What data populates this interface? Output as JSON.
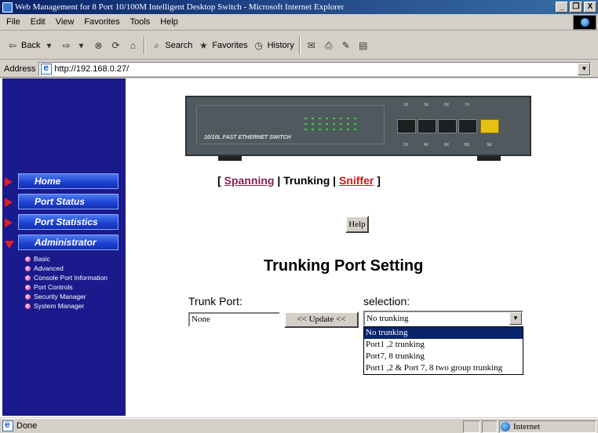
{
  "window": {
    "title": "Web Management for 8 Port 10/100M Intelligent Desktop Switch - Microsoft Internet Explorer",
    "buttons": [
      "_",
      "̅̅̅⨯",
      "X"
    ],
    "minimize": "_",
    "restore": "❒",
    "close": "X"
  },
  "menu": {
    "items": [
      "File",
      "Edit",
      "View",
      "Favorites",
      "Tools",
      "Help"
    ]
  },
  "toolbar": {
    "back": "Back",
    "search": "Search",
    "favorites": "Favorites",
    "history": "History"
  },
  "address": {
    "label": "Address",
    "url": "http://192.168.0.27/"
  },
  "device": {
    "brand": "10/10L FAST ETHERNET SWITCH",
    "port_labels": [
      "1X",
      "3X",
      "5X",
      "7X",
      "2X",
      "4X",
      "6X",
      "8X",
      "SE"
    ]
  },
  "sidebar": {
    "nav": [
      {
        "label": "Home"
      },
      {
        "label": "Port Status"
      },
      {
        "label": "Port Statistics"
      },
      {
        "label": "Administrator"
      }
    ],
    "sub": [
      "Basic",
      "Advanced",
      "Console Port Information",
      "Port Controls",
      "Security Manager",
      "System Manager"
    ]
  },
  "tabs": {
    "open": "[",
    "spanning": "Spanning",
    "sep": "|",
    "trunking": "Trunking",
    "sniffer": "Sniffer",
    "close": "]"
  },
  "help_button": "Help",
  "heading": "Trunking Port Setting",
  "trunk": {
    "label": "Trunk Port:",
    "value": "None",
    "update_button": "<< Update <<"
  },
  "selection": {
    "label": "selection:",
    "selected": "No trunking",
    "options": [
      "No trunking",
      "Port1 ,2 trunking",
      "Port7, 8 trunking",
      "Port1 ,2 & Port 7, 8 two group trunking"
    ]
  },
  "status": {
    "text": "Done",
    "zone": "Internet"
  },
  "colors": {
    "sidebar": "#1a1a8c",
    "nav_pill": "#1c3fd0",
    "spanning_link": "#8b2252",
    "sniffer_link": "#d01818",
    "selected_option": "#0a246a"
  }
}
